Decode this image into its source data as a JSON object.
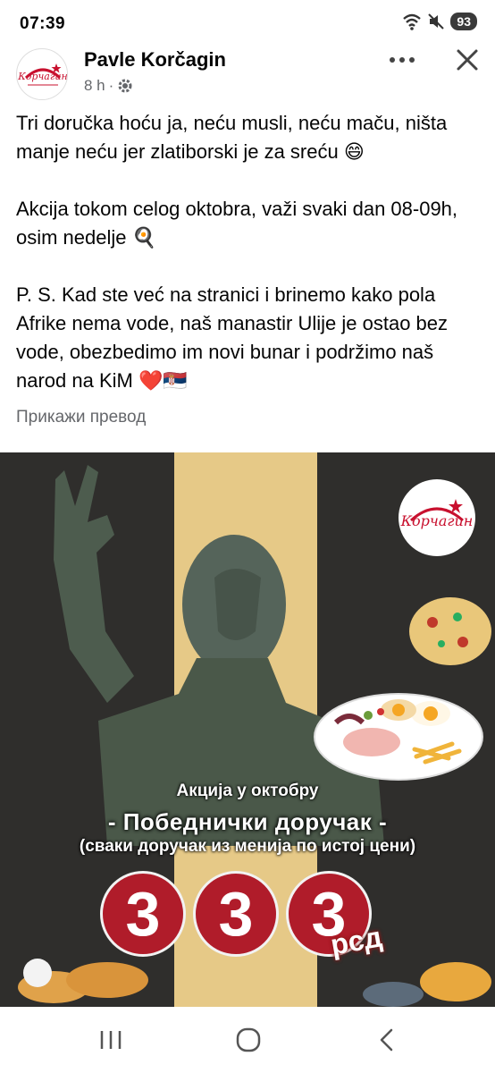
{
  "status_bar": {
    "time": "07:39",
    "battery": "93",
    "icons": [
      "wifi-icon",
      "mute-icon",
      "battery-icon"
    ]
  },
  "post": {
    "author": "Pavle Korčagin",
    "time_ago": "8 h",
    "privacy_icon": "settings-gear-icon",
    "paragraphs": [
      "Tri doručka hoću ja, neću musli, neću maču, ništa manje neću jer zlatiborski je za sreću 😄",
      "Akcija tokom celog oktobra, važi svaki dan 08-09h, osim nedelje 🍳",
      "P. S. Kad ste već na stranici i brinemo kako pola Afrike nema vode, naš manastir Ulije je ostao bez vode, obezbedimo im novi bunar i podržimo naš narod na KiM ❤️🇷🇸"
    ],
    "translate_link": "Прикажи превод"
  },
  "ad": {
    "caption_top": "Акција у октобру",
    "caption_main": "- Победнички доручак -",
    "caption_sub": "(сваки доручак из менија по истој цени)",
    "price_digits": [
      "3",
      "3",
      "3"
    ],
    "price_unit": "рсд",
    "brand_logo_text": "Корчагин",
    "colors": {
      "background": "#2f2e2c",
      "stripe": "#e6c987",
      "price_red": "#b01c2a"
    }
  },
  "nav_bar": {
    "buttons": [
      "recent-apps-icon",
      "home-icon",
      "back-icon"
    ]
  }
}
